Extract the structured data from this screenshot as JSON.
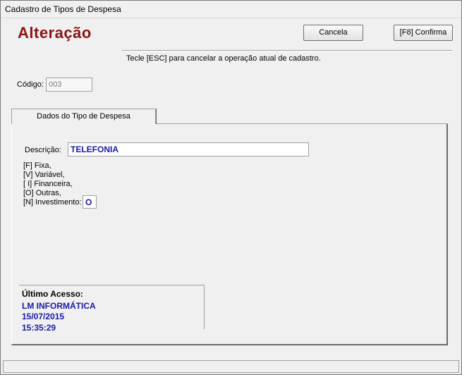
{
  "window": {
    "title": "Cadastro de Tipos de Despesa"
  },
  "header": {
    "mode_title": "Alteração",
    "cancel_label": "Cancela",
    "confirm_label": "[F8]  Confirma",
    "hint": "Tecle [ESC] para cancelar a operação atual de cadastro."
  },
  "code": {
    "label": "Código:",
    "value": "003"
  },
  "tabs": [
    {
      "label": "Dados do Tipo de Despesa"
    }
  ],
  "form": {
    "description_label": "Descrição:",
    "description_value": "TELEFONIA",
    "type_options": [
      "[F] Fixa,",
      "[V] Variável,",
      "[ I] Financeira,",
      "[O] Outras,",
      "[N] Investimento:"
    ],
    "type_value": "O"
  },
  "last_access": {
    "title": "Último Acesso:",
    "user": "LM INFORMÁTICA",
    "date": "15/07/2015",
    "time": "15:35:29"
  },
  "colors": {
    "mode_title": "#8b1414",
    "value_text": "#1a1aa6"
  }
}
